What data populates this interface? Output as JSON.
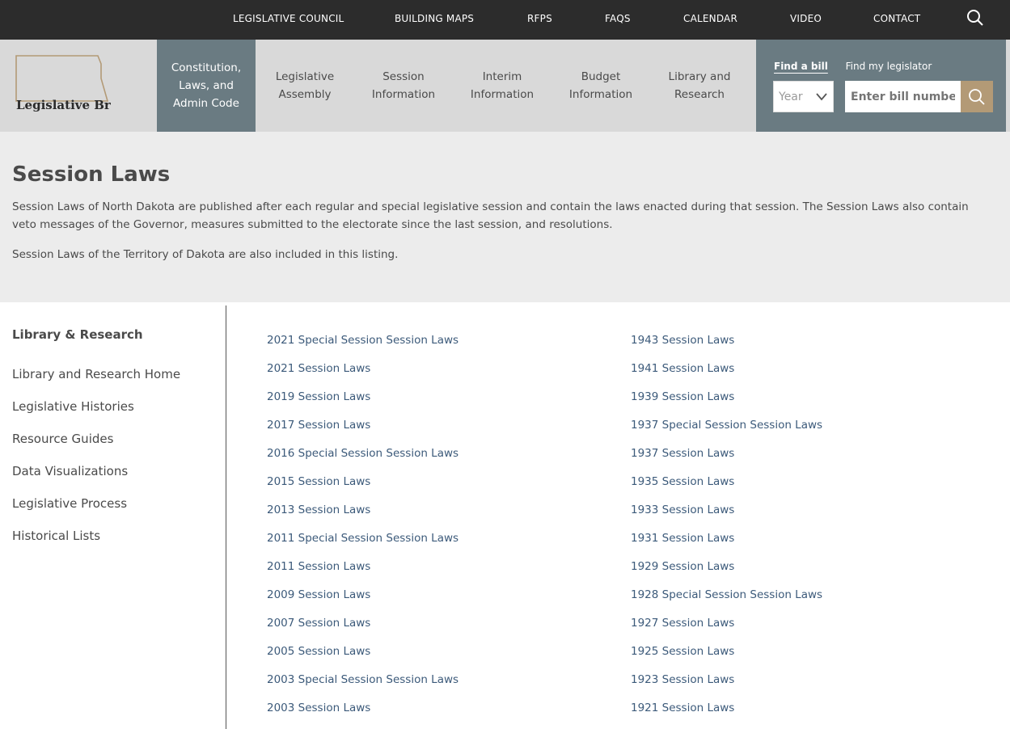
{
  "topbar": {
    "links": [
      "LEGISLATIVE COUNCIL",
      "BUILDING MAPS",
      "RFPS",
      "FAQS",
      "CALENDAR",
      "VIDEO",
      "CONTACT"
    ]
  },
  "logo": {
    "text": "Legislative Branch"
  },
  "nav": [
    "Constitution, Laws, and Admin Code",
    "Legislative Assembly",
    "Session Information",
    "Interim Information",
    "Budget Information",
    "Library and Research"
  ],
  "find": {
    "tab_bill": "Find a bill",
    "tab_legislator": "Find my legislator",
    "year_label": "Year",
    "bill_placeholder": "Enter bill number"
  },
  "intro": {
    "title": "Session Laws",
    "p1": "Session Laws of North Dakota are published after each regular and special legislative session and contain the laws enacted during that session.  The Session Laws also contain veto messages of the Governor, measures submitted to the electorate since the last session, and resolutions.",
    "p2": "Session Laws of the Territory of Dakota are also included in this listing."
  },
  "sidebar": {
    "title": "Library & Research",
    "items": [
      "Library and Research Home",
      "Legislative Histories",
      "Resource Guides",
      "Data Visualizations",
      "Legislative Process",
      "Historical Lists"
    ]
  },
  "links": {
    "left": [
      "2021 Special Session Session Laws",
      "2021 Session Laws",
      "2019 Session Laws",
      "2017 Session Laws",
      "2016 Special Session Session Laws",
      "2015 Session Laws",
      "2013 Session Laws",
      "2011 Special Session Session Laws",
      "2011 Session Laws",
      "2009 Session Laws",
      "2007 Session Laws",
      "2005 Session Laws",
      "2003 Special Session Session Laws",
      "2003 Session Laws"
    ],
    "right": [
      "1943 Session Laws",
      "1941 Session Laws",
      "1939 Session Laws",
      "1937 Special Session Session Laws",
      "1937 Session Laws",
      "1935 Session Laws",
      "1933 Session Laws",
      "1931 Session Laws",
      "1929 Session Laws",
      "1928 Special Session Session Laws",
      "1927 Session Laws",
      "1925 Session Laws",
      "1923 Session Laws",
      "1921 Session Laws"
    ]
  },
  "colors": {
    "accent": "#6a7b82",
    "button": "#b39a76",
    "link": "#3c5a7a"
  }
}
